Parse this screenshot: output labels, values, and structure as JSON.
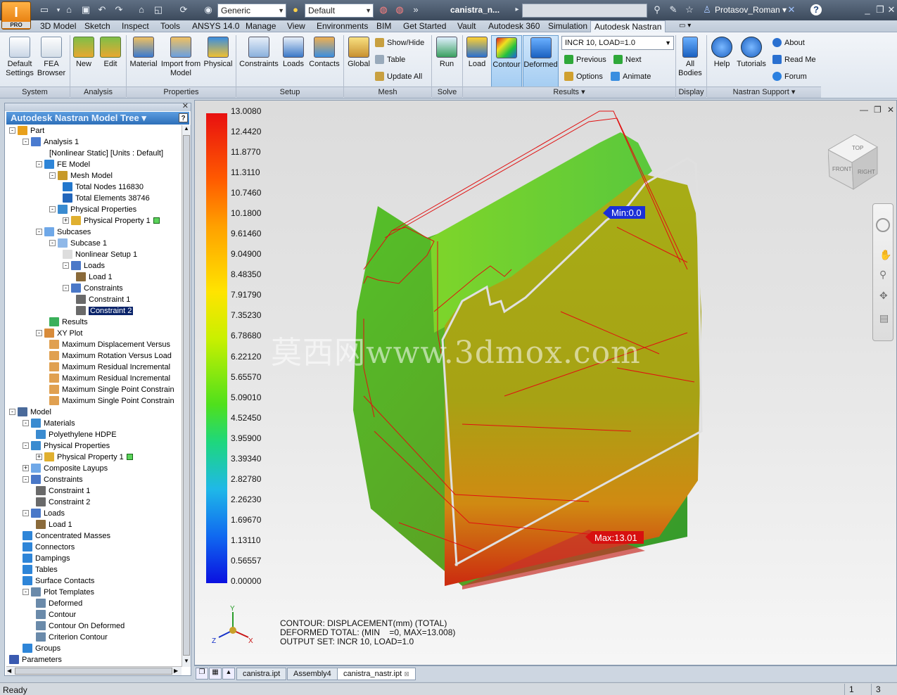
{
  "app": {
    "pro_badge": "PRO",
    "material_combo": "Generic",
    "appearance_combo": "Default",
    "doc_title": "canistra_n...",
    "user": "Protasov_Roman"
  },
  "tabs": [
    "3D Model",
    "Sketch",
    "Inspect",
    "Tools",
    "ANSYS 14.0",
    "Manage",
    "View",
    "Environments",
    "BIM",
    "Get Started",
    "Vault",
    "Autodesk 360",
    "Simulation",
    "Autodesk Nastran"
  ],
  "active_tab": "Autodesk Nastran",
  "ribbon": {
    "system": {
      "label": "System",
      "default_settings": "Default Settings",
      "fea_browser": "FEA Browser"
    },
    "analysis": {
      "label": "Analysis",
      "new": "New",
      "edit": "Edit"
    },
    "properties": {
      "label": "Properties",
      "material": "Material",
      "import_model": "Import from Model",
      "physical": "Physical"
    },
    "setup": {
      "label": "Setup",
      "constraints": "Constraints",
      "loads": "Loads",
      "contacts": "Contacts"
    },
    "mesh": {
      "label": "Mesh",
      "global": "Global",
      "show_hide": "Show/Hide",
      "table": "Table",
      "update_all": "Update All"
    },
    "solve": {
      "label": "Solve",
      "run": "Run"
    },
    "results": {
      "label": "Results",
      "load": "Load",
      "contour": "Contour",
      "deformed": "Deformed",
      "incr_combo": "INCR 10, LOAD=1.0",
      "previous": "Previous",
      "next": "Next",
      "options": "Options",
      "animate": "Animate"
    },
    "display": {
      "label": "Display",
      "all_bodies": "All Bodies"
    },
    "support": {
      "label": "Nastran Support",
      "help": "Help",
      "tutorials": "Tutorials",
      "about": "About",
      "read_me": "Read Me",
      "forum": "Forum"
    }
  },
  "tree": {
    "header": "Autodesk Nastran Model Tree",
    "help": "?",
    "items": [
      {
        "label": "Part",
        "indent": 0,
        "exp": "-",
        "icon": "#e8a01c"
      },
      {
        "label": "Analysis 1",
        "indent": 1,
        "exp": "-",
        "icon": "#4a7bd0"
      },
      {
        "label": "[Nonlinear Static] [Units : Default]",
        "indent": 3,
        "exp": "",
        "icon": ""
      },
      {
        "label": "FE Model",
        "indent": 2,
        "exp": "-",
        "icon": "#2e85d8"
      },
      {
        "label": "Mesh Model",
        "indent": 3,
        "exp": "-",
        "icon": "#c79a2a"
      },
      {
        "label": "Total Nodes 116830",
        "indent": 4,
        "exp": "",
        "icon": "#2277cc"
      },
      {
        "label": "Total Elements 38746",
        "indent": 4,
        "exp": "",
        "icon": "#2266bb"
      },
      {
        "label": "Physical Properties",
        "indent": 3,
        "exp": "-",
        "icon": "#3a8bd0"
      },
      {
        "label": "Physical Property 1",
        "indent": 4,
        "exp": "+",
        "icon": "#e0b030",
        "green": true
      },
      {
        "label": "Subcases",
        "indent": 2,
        "exp": "-",
        "icon": "#6fa8e8"
      },
      {
        "label": "Subcase 1",
        "indent": 3,
        "exp": "-",
        "icon": "#8fb8e8"
      },
      {
        "label": "Nonlinear Setup 1",
        "indent": 4,
        "exp": "",
        "icon": "#dddddd"
      },
      {
        "label": "Loads",
        "indent": 4,
        "exp": "-",
        "icon": "#4a78c8"
      },
      {
        "label": "Load 1",
        "indent": 5,
        "exp": "",
        "icon": "#8a6a3a"
      },
      {
        "label": "Constraints",
        "indent": 4,
        "exp": "-",
        "icon": "#4a78c8"
      },
      {
        "label": "Constraint 1",
        "indent": 5,
        "exp": "",
        "icon": "#6a6a6a"
      },
      {
        "label": "Constraint 2",
        "indent": 5,
        "exp": "",
        "icon": "#6a6a6a",
        "selected": true
      },
      {
        "label": "Results",
        "indent": 3,
        "exp": "",
        "icon": "#3ab05a"
      },
      {
        "label": "XY Plot",
        "indent": 2,
        "exp": "-",
        "icon": "#d88b3a"
      },
      {
        "label": "Maximum Displacement Versus",
        "indent": 3,
        "exp": "",
        "icon": "#e0a050"
      },
      {
        "label": "Maximum Rotation Versus Load",
        "indent": 3,
        "exp": "",
        "icon": "#e0a050"
      },
      {
        "label": "Maximum Residual Incremental",
        "indent": 3,
        "exp": "",
        "icon": "#e0a050"
      },
      {
        "label": "Maximum Residual Incremental",
        "indent": 3,
        "exp": "",
        "icon": "#e0a050"
      },
      {
        "label": "Maximum Single Point Constrain",
        "indent": 3,
        "exp": "",
        "icon": "#e0a050"
      },
      {
        "label": "Maximum Single Point Constrain",
        "indent": 3,
        "exp": "",
        "icon": "#e0a050"
      },
      {
        "label": "Model",
        "indent": 0,
        "exp": "-",
        "icon": "#4a6a9a"
      },
      {
        "label": "Materials",
        "indent": 1,
        "exp": "-",
        "icon": "#3a8bd0"
      },
      {
        "label": "Polyethylene HDPE",
        "indent": 2,
        "exp": "",
        "icon": "#3a8bd0"
      },
      {
        "label": "Physical Properties",
        "indent": 1,
        "exp": "-",
        "icon": "#3a8bd0"
      },
      {
        "label": "Physical Property 1",
        "indent": 2,
        "exp": "+",
        "icon": "#e0b030",
        "green": true
      },
      {
        "label": "Composite Layups",
        "indent": 1,
        "exp": "+",
        "icon": "#6fa8e8"
      },
      {
        "label": "Constraints",
        "indent": 1,
        "exp": "-",
        "icon": "#4a78c8"
      },
      {
        "label": "Constraint 1",
        "indent": 2,
        "exp": "",
        "icon": "#6a6a6a"
      },
      {
        "label": "Constraint 2",
        "indent": 2,
        "exp": "",
        "icon": "#6a6a6a"
      },
      {
        "label": "Loads",
        "indent": 1,
        "exp": "-",
        "icon": "#4a78c8"
      },
      {
        "label": "Load 1",
        "indent": 2,
        "exp": "",
        "icon": "#8a6a3a"
      },
      {
        "label": "Concentrated Masses",
        "indent": 1,
        "exp": "",
        "icon": "#2e85d8"
      },
      {
        "label": "Connectors",
        "indent": 1,
        "exp": "",
        "icon": "#2e85d8"
      },
      {
        "label": "Dampings",
        "indent": 1,
        "exp": "",
        "icon": "#2e85d8"
      },
      {
        "label": "Tables",
        "indent": 1,
        "exp": "",
        "icon": "#2e85d8"
      },
      {
        "label": "Surface Contacts",
        "indent": 1,
        "exp": "",
        "icon": "#2e85d8"
      },
      {
        "label": "Plot Templates",
        "indent": 1,
        "exp": "-",
        "icon": "#6a8aaa"
      },
      {
        "label": "Deformed",
        "indent": 2,
        "exp": "",
        "icon": "#6a8aaa"
      },
      {
        "label": "Contour",
        "indent": 2,
        "exp": "",
        "icon": "#6a8aaa"
      },
      {
        "label": "Contour On Deformed",
        "indent": 2,
        "exp": "",
        "icon": "#6a8aaa"
      },
      {
        "label": "Criterion Contour",
        "indent": 2,
        "exp": "",
        "icon": "#6a8aaa"
      },
      {
        "label": "Groups",
        "indent": 1,
        "exp": "",
        "icon": "#2e85d8"
      },
      {
        "label": "Parameters",
        "indent": 0,
        "exp": "",
        "icon": "#3a5ab0"
      }
    ]
  },
  "legend_values": [
    "13.0080",
    "12.4420",
    "11.8770",
    "11.3110",
    "10.7460",
    "10.1800",
    "9.61460",
    "9.04900",
    "8.48350",
    "7.91790",
    "7.35230",
    "6.78680",
    "6.22120",
    "5.65570",
    "5.09010",
    "4.52450",
    "3.95900",
    "3.39340",
    "2.82780",
    "2.26230",
    "1.69670",
    "1.13110",
    "0.56557",
    "0.00000"
  ],
  "viewport": {
    "min_label": "Min:0.0",
    "max_label": "Max:13.01",
    "watermark": "莫西网www.3dmox.com",
    "contour_line": "CONTOUR: DISPLACEMENT(mm) (TOTAL)",
    "deformed_line": "DEFORMED TOTAL: (MIN    =0, MAX=13.008)",
    "output_line": "OUTPUT SET: INCR 10, LOAD=1.0",
    "viewcube_top": "TOP",
    "viewcube_front": "FRONT",
    "viewcube_right": "RIGHT",
    "axis_y": "Y",
    "axis_x": "X",
    "axis_z": "Z"
  },
  "doc_tabs": [
    "canistra.ipt",
    "Assembly4",
    "canistra_nastr.ipt"
  ],
  "active_doc": "canistra_nastr.ipt",
  "status": {
    "ready": "Ready",
    "cell1": "1",
    "cell2": "3"
  }
}
